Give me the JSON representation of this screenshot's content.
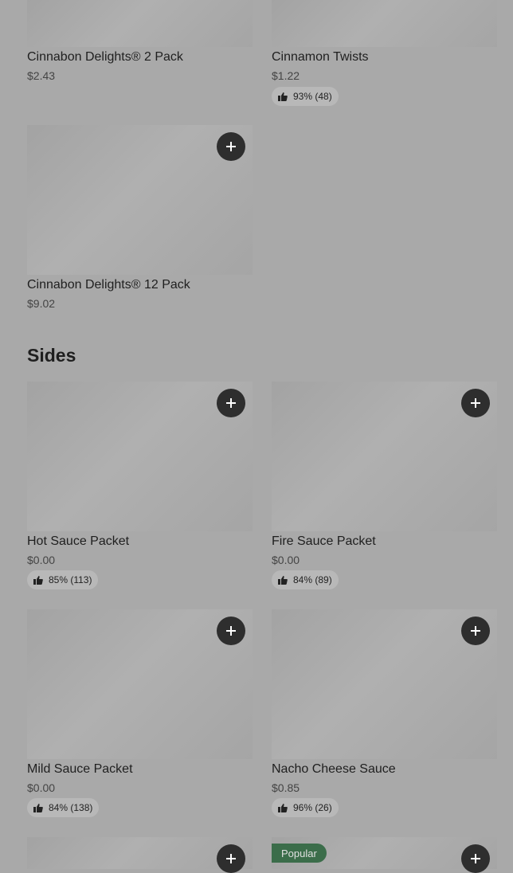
{
  "top_items": [
    {
      "name": "Cinnabon Delights® 2 Pack",
      "price": "$2.43"
    },
    {
      "name": "Cinnamon Twists",
      "price": "$1.22",
      "rating": "93% (48)"
    },
    {
      "name": "Cinnabon Delights® 12 Pack",
      "price": "$9.02"
    }
  ],
  "sides": {
    "title": "Sides",
    "items": [
      {
        "name": "Hot Sauce Packet",
        "price": "$0.00",
        "rating": "85% (113)"
      },
      {
        "name": "Fire Sauce Packet",
        "price": "$0.00",
        "rating": "84% (89)"
      },
      {
        "name": "Mild Sauce Packet",
        "price": "$0.00",
        "rating": "84% (138)"
      },
      {
        "name": "Nacho Cheese Sauce",
        "price": "$0.85",
        "rating": "96% (26)"
      },
      {
        "badge": "Popular"
      }
    ]
  },
  "icons": {
    "add": "plus-icon",
    "rating": "thumbs-up-icon"
  },
  "colors": {
    "background": "#a9a9a9",
    "add_button": "#2e2e2e",
    "popular_badge": "#3b6d4a"
  }
}
